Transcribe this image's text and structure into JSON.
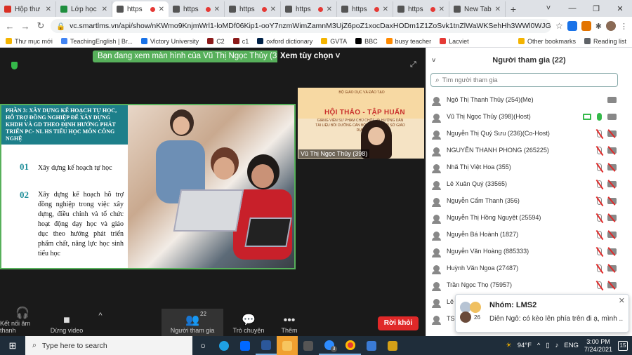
{
  "tabs": [
    {
      "label": "Hộp thư",
      "color": "#d93025"
    },
    {
      "label": "Lớp học",
      "color": "#1e8e3e"
    },
    {
      "label": "https",
      "color": "#555555"
    },
    {
      "label": "https",
      "color": "#555555"
    },
    {
      "label": "https",
      "color": "#555555"
    },
    {
      "label": "https",
      "color": "#555555"
    },
    {
      "label": "https",
      "color": "#555555"
    },
    {
      "label": "https",
      "color": "#555555"
    },
    {
      "label": "New Tab",
      "color": "#555555"
    }
  ],
  "address": {
    "url": "vc.smartlms.vn/api/show/nKWmo9KnjmWrl1-loMDf06Kip1-ooY7nzmWimZamnM3UjZ6poZ1xocDaxHODm1Z1ZoSvk1tnZlWaWKSehHh3WWl0WJGds..."
  },
  "bookmarks": {
    "items": [
      {
        "label": "Thư mục mới",
        "color": "#f4b400"
      },
      {
        "label": "TeachingEnglish | Br...",
        "color": "#4285f4"
      },
      {
        "label": "Victory University",
        "color": "#1a73e8"
      },
      {
        "label": "C2",
        "color": "#8b1a1a"
      },
      {
        "label": "c1",
        "color": "#8b1a1a"
      },
      {
        "label": "oxford dictionary",
        "color": "#002147"
      },
      {
        "label": "GVTA",
        "color": "#f4b400"
      },
      {
        "label": "BBC",
        "color": "#000000"
      },
      {
        "label": "busy teacher",
        "color": "#ff8a00"
      },
      {
        "label": "Lacviet",
        "color": "#e53935"
      }
    ],
    "other": "Other bookmarks",
    "reading": "Reading list"
  },
  "meeting": {
    "banner": "Bạn đang xem màn hình của Vũ Thị Ngọc Thủy (398)",
    "view_options": "Xem tùy chọn ˅",
    "slide": {
      "heading": "PHẦN 3: XÂY DỰNG KẾ HOẠCH TỰ HỌC, HỖ TRỢ ĐỒNG NGHIỆP ĐỂ XÂY DỰNG KHDH VÀ GD THEO ĐỊNH HƯỚNG PHÁT TRIỂN PC- NL HS TIỂU HỌC MÔN CÔNG NGHỆ",
      "items": [
        {
          "num": "01",
          "text": "Xây dựng kế hoạch tự học"
        },
        {
          "num": "02",
          "text": "Xây dựng kế hoạch hỗ trợ đồng nghiệp trong việc xây dựng, điều chỉnh và tổ chức hoạt động dạy học và giáo dục theo hướng phát triển phẩm chất, năng lực học sinh tiểu học"
        }
      ]
    },
    "video": {
      "small_top": "BỘ GIÁO DỤC VÀ ĐÀO TẠO",
      "title": "HỘI THẢO - TẬP HUẤN",
      "body": "GIẢNG VIÊN SƯ PHẠM CHỦ CHỐT VÀ HƯỚNG DẪN TÀI LIỆU BỒI DƯỠNG CÁN BỘ QUẢN LÝ CƠ SỞ GIÁO DỤC",
      "name": "Vũ Thị Ngọc Thủy (398)"
    },
    "toolbar": {
      "audio": "Kết nối âm thanh",
      "video": "Dừng video",
      "participants": "Người tham gia",
      "participants_count": "22",
      "chat": "Trò chuyện",
      "more": "Thêm",
      "leave": "Rời khỏi"
    }
  },
  "panel": {
    "title": "Người tham gia (22)",
    "search_placeholder": "Tìm người tham gia",
    "participants": [
      {
        "name": "Ngô Thị Thanh Thủy (254)(Me)",
        "mic": "none",
        "cam": "on"
      },
      {
        "name": "Vũ Thị Ngọc Thủy (398)(Host)",
        "mic": "on",
        "cam": "on",
        "share": true
      },
      {
        "name": "Nguyễn Thị Quý Sưu (236)(Co-Host)",
        "mic": "muted",
        "cam": "muted"
      },
      {
        "name": "NGUYỄN THANH PHONG (265225)",
        "mic": "muted",
        "cam": "muted"
      },
      {
        "name": "Nhã Thị Việt Hoa (355)",
        "mic": "muted",
        "cam": "muted"
      },
      {
        "name": "Lê Xuân Quý (33565)",
        "mic": "muted",
        "cam": "muted"
      },
      {
        "name": "Nguyễn Cẩm Thanh (356)",
        "mic": "muted",
        "cam": "muted"
      },
      {
        "name": "Nguyễn Thị Hồng Nguyệt (25594)",
        "mic": "muted",
        "cam": "muted"
      },
      {
        "name": "Nguyễn Bá Hoành (1827)",
        "mic": "muted",
        "cam": "muted"
      },
      {
        "name": "Nguyễn Văn Hoàng (885333)",
        "mic": "muted",
        "cam": "muted"
      },
      {
        "name": "Huỳnh Văn Ngoa (27487)",
        "mic": "muted",
        "cam": "muted"
      },
      {
        "name": "Trần Ngọc Thọ (75957)",
        "mic": "muted",
        "cam": "muted"
      },
      {
        "name": "Lê",
        "mic": "muted",
        "cam": "muted"
      },
      {
        "name": "TS",
        "mic": "muted",
        "cam": "muted"
      }
    ]
  },
  "chat_popup": {
    "title": "Nhóm: LMS2",
    "count": "26",
    "message": "Diên Ngô: có kèo lên phía trên đi ạ, mình ..."
  },
  "taskbar": {
    "search_placeholder": "Type here to search",
    "weather": "94°F",
    "lang": "ENG",
    "time": "3:00 PM",
    "date": "7/24/2021",
    "notifications": "15",
    "badge": "3"
  }
}
